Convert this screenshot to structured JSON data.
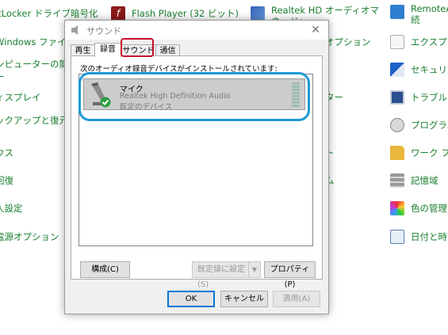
{
  "control_panel": {
    "left_column": [
      {
        "label": "itLocker ドライブ暗号化",
        "icon": "bitlocker-icon"
      },
      {
        "label": "Windows ファイアウォール",
        "icon": "firewall-icon"
      },
      {
        "label": "ンピューターの簡単操",
        "icon": "accessibility-icon"
      },
      {
        "label": "ー",
        "icon": ""
      },
      {
        "label": "ィスプレイ",
        "icon": "display-icon"
      },
      {
        "label": "ックアップと復元 (W",
        "icon": "backup-icon"
      },
      {
        "label": "ウス",
        "icon": "mouse-icon"
      },
      {
        "label": "回復",
        "icon": "recovery-icon"
      },
      {
        "label": "人設定",
        "icon": "personalization-icon"
      },
      {
        "label": "電源オプション",
        "icon": "power-icon"
      }
    ],
    "middle_column": [
      {
        "label": "Flash Player (32 ビット)",
        "icon": "flash-icon"
      },
      {
        "label": "Realtek HD オーディオマネージャ",
        "icon": "realtek-icon"
      },
      {
        "label": "オプション",
        "icon": ""
      },
      {
        "label": "ター",
        "icon": ""
      },
      {
        "label": "ト",
        "icon": ""
      },
      {
        "label": "ム",
        "icon": ""
      }
    ],
    "right_column": [
      {
        "label": "RemoteA 続",
        "icon": "remote-icon"
      },
      {
        "label": "エクスプロ",
        "icon": "explorer-icon"
      },
      {
        "label": "セキュリティ",
        "icon": "security-flag-icon"
      },
      {
        "label": "トラブルシ",
        "icon": "troubleshoot-icon"
      },
      {
        "label": "プログラム",
        "icon": "programs-icon"
      },
      {
        "label": "ワーク フォ",
        "icon": "work-folders-icon"
      },
      {
        "label": "記憶域",
        "icon": "storage-icon"
      },
      {
        "label": "色の管理",
        "icon": "color-management-icon"
      },
      {
        "label": "日付と時刻",
        "icon": "datetime-icon"
      }
    ]
  },
  "dialog": {
    "title": "サウンド",
    "tabs": [
      "再生",
      "録音",
      "サウンド",
      "通信"
    ],
    "active_tab": "録音",
    "description": "次のオーディオ録音デバイスがインストールされています:",
    "device": {
      "name": "マイク",
      "description": "Realtek High Definition Audio",
      "status": "既定のデバイス"
    },
    "buttons": {
      "configure": "構成(C)",
      "set_default": "既定値に設定(S)",
      "properties": "プロパティ(P)",
      "ok": "OK",
      "cancel": "キャンセル",
      "apply": "適用(A)"
    }
  },
  "colors": {
    "link_green": "#1a7f2e",
    "highlight_red": "#c8102e",
    "highlight_blue": "#1e9ad6",
    "check_green": "#2ea043"
  }
}
